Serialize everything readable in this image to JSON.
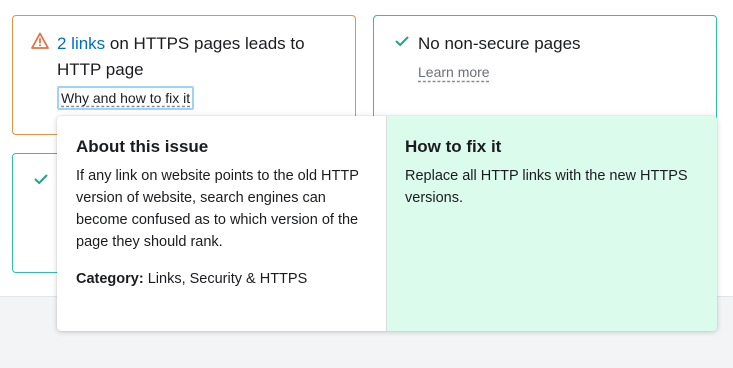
{
  "issue_card": {
    "link_text": "2 links",
    "text": " on HTTPS pages leads to HTTP page",
    "fix_link": "Why and how to fix it"
  },
  "ok_card": {
    "text": "No non-secure pages",
    "learn_more": "Learn more"
  },
  "popover": {
    "about": {
      "title": "About this issue",
      "body": "If any link on website points to the old HTTP version of website, search engines can become confused as to which version of the page they should rank.",
      "category_label": "Category:",
      "category_value": " Links, Security & HTTPS"
    },
    "fix": {
      "title": "How to fix it",
      "body": "Replace all HTTP links with the new HTTPS versions."
    }
  },
  "colors": {
    "warning": "#e6913f",
    "success": "#29c2a6",
    "link": "#006dca",
    "fix_panel_bg": "#dbfbec"
  },
  "icons": {
    "warning": "warning-triangle-icon",
    "check": "check-icon"
  }
}
